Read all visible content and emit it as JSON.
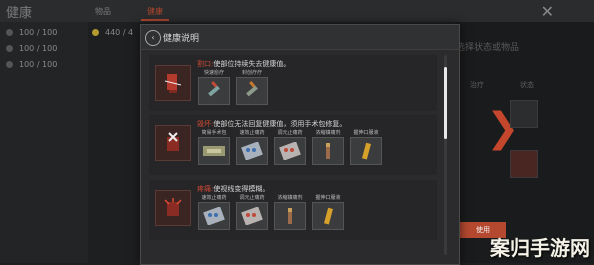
{
  "background": {
    "title": "健康",
    "tabs": [
      "物品",
      "健康"
    ],
    "stats": [
      {
        "label": "100 / 100"
      },
      {
        "label": "100 / 100"
      },
      {
        "label": "100 / 100"
      }
    ],
    "stat_top": "440 / 4",
    "right_hint": "选择状态或物品",
    "right_cols": [
      "治疗",
      "状态"
    ],
    "accept_label": "使用",
    "accent": "#c4472d"
  },
  "modal": {
    "title": "健康说明",
    "sections": [
      {
        "name": "割口:",
        "desc": "使部位持续失去健康值。",
        "icon": "bleeding-leg-icon",
        "items": [
          {
            "label": "快速愈疗",
            "icon": "syringe-icon"
          },
          {
            "label": "封创疗疗",
            "icon": "syringe-icon"
          }
        ]
      },
      {
        "name": "毁坏:",
        "desc": "使部位无法回复健康值，须用手术包修复。",
        "icon": "destroyed-torso-icon",
        "items": [
          {
            "label": "简易手术包",
            "icon": "surgery-kit-icon"
          },
          {
            "label": "速效止痛药",
            "icon": "pill-blister-icon"
          },
          {
            "label": "调元止痛药",
            "icon": "pill-blister-icon"
          },
          {
            "label": "浓缩镇痛剂",
            "icon": "syringe-icon"
          },
          {
            "label": "握伸口服液",
            "icon": "tube-icon"
          }
        ]
      },
      {
        "name": "疼痛:",
        "desc": "使视线变得模糊。",
        "icon": "pain-torso-icon",
        "items": [
          {
            "label": "速效止痛药",
            "icon": "pill-blister-icon"
          },
          {
            "label": "调元止痛药",
            "icon": "pill-blister-icon"
          },
          {
            "label": "浓缩镇痛剂",
            "icon": "syringe-icon"
          },
          {
            "label": "握伸口服液",
            "icon": "tube-icon"
          }
        ]
      }
    ]
  },
  "watermark": "案归手游网"
}
